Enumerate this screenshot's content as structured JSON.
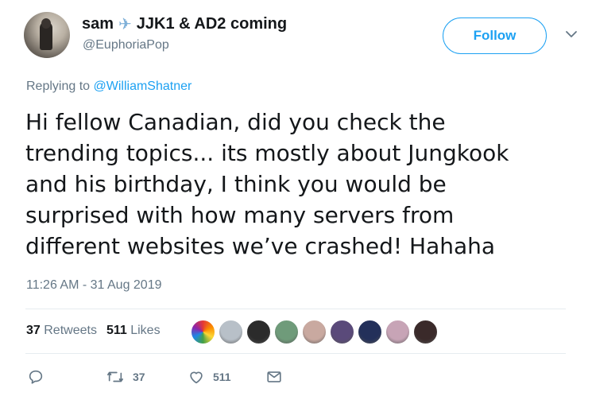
{
  "user": {
    "display_name": "sam",
    "name_emoji": "✈",
    "name_suffix": "JJK1 & AD2 coming",
    "handle": "@EuphoriaPop"
  },
  "follow_label": "Follow",
  "reply": {
    "prefix": "Replying to",
    "mention": "@WilliamShatner"
  },
  "text_lines": [
    "Hi fellow Canadian, did you check the",
    "trending topics... its mostly about Jungkook",
    "and his birthday, I think you would be",
    "surprised with how many servers from",
    "different websites we’ve crashed! Hahaha"
  ],
  "timestamp": "11:26 AM - 31 Aug 2019",
  "stats": {
    "retweets_count": "37",
    "retweets_label": "Retweets",
    "likes_count": "511",
    "likes_label": "Likes"
  },
  "likers_colors": [
    "#e86a8c",
    "#b8c0c8",
    "#2b2b2b",
    "#6f9b7a",
    "#c9a9a0",
    "#5a4a7a",
    "#23305a",
    "#c7a4b6",
    "#3a2a2a"
  ],
  "actions": {
    "reply_icon": "reply-icon",
    "retweet_icon": "retweet-icon",
    "retweet_count": "37",
    "like_icon": "heart-icon",
    "like_count": "511",
    "dm_icon": "envelope-icon"
  },
  "colors": {
    "accent": "#1da1f2",
    "muted": "#657786",
    "text": "#14171a"
  }
}
